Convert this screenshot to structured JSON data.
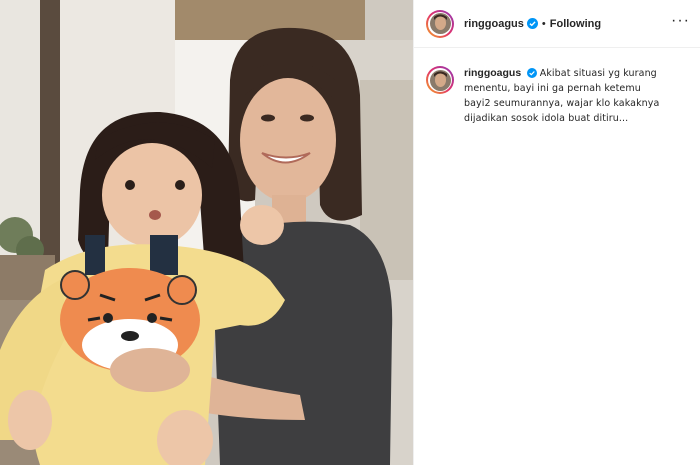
{
  "post": {
    "username": "ringgoagus",
    "verified_icon": "verified-badge-icon",
    "separator": "•",
    "follow_status": "Following",
    "more_icon": "more-options-icon",
    "more_glyph": "···",
    "caption": "Akibat situasi yg kurang menentu, bayi ini ga pernah ketemu bayi2 seumurannya, wajar klo kakaknya dijadikan sosok idola buat ditiru...",
    "accent_color": "#0095f6",
    "border_color": "#efefef"
  }
}
